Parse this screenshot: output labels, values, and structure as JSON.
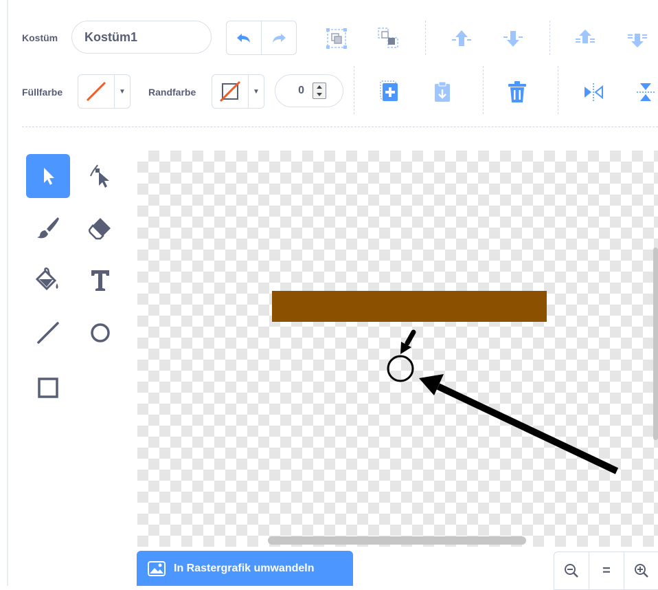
{
  "toolbar": {
    "costume_label": "Kostüm",
    "costume_name": "Kostüm1",
    "fill_label": "Füllfarbe",
    "outline_label": "Randfarbe",
    "outline_width": "0"
  },
  "tools": [
    "select",
    "reshape",
    "brush",
    "eraser",
    "fill",
    "text",
    "line",
    "circle",
    "rectangle"
  ],
  "selected_tool": "select",
  "colors": {
    "accent": "#4c97ff",
    "rect_fill": "#8b5000",
    "swatch_slash": "#f25c26",
    "text": "#575e75"
  },
  "footer": {
    "convert_button": "In Rastergrafik umwandeln",
    "zoom_out": "−",
    "zoom_reset": "=",
    "zoom_in": "+"
  }
}
